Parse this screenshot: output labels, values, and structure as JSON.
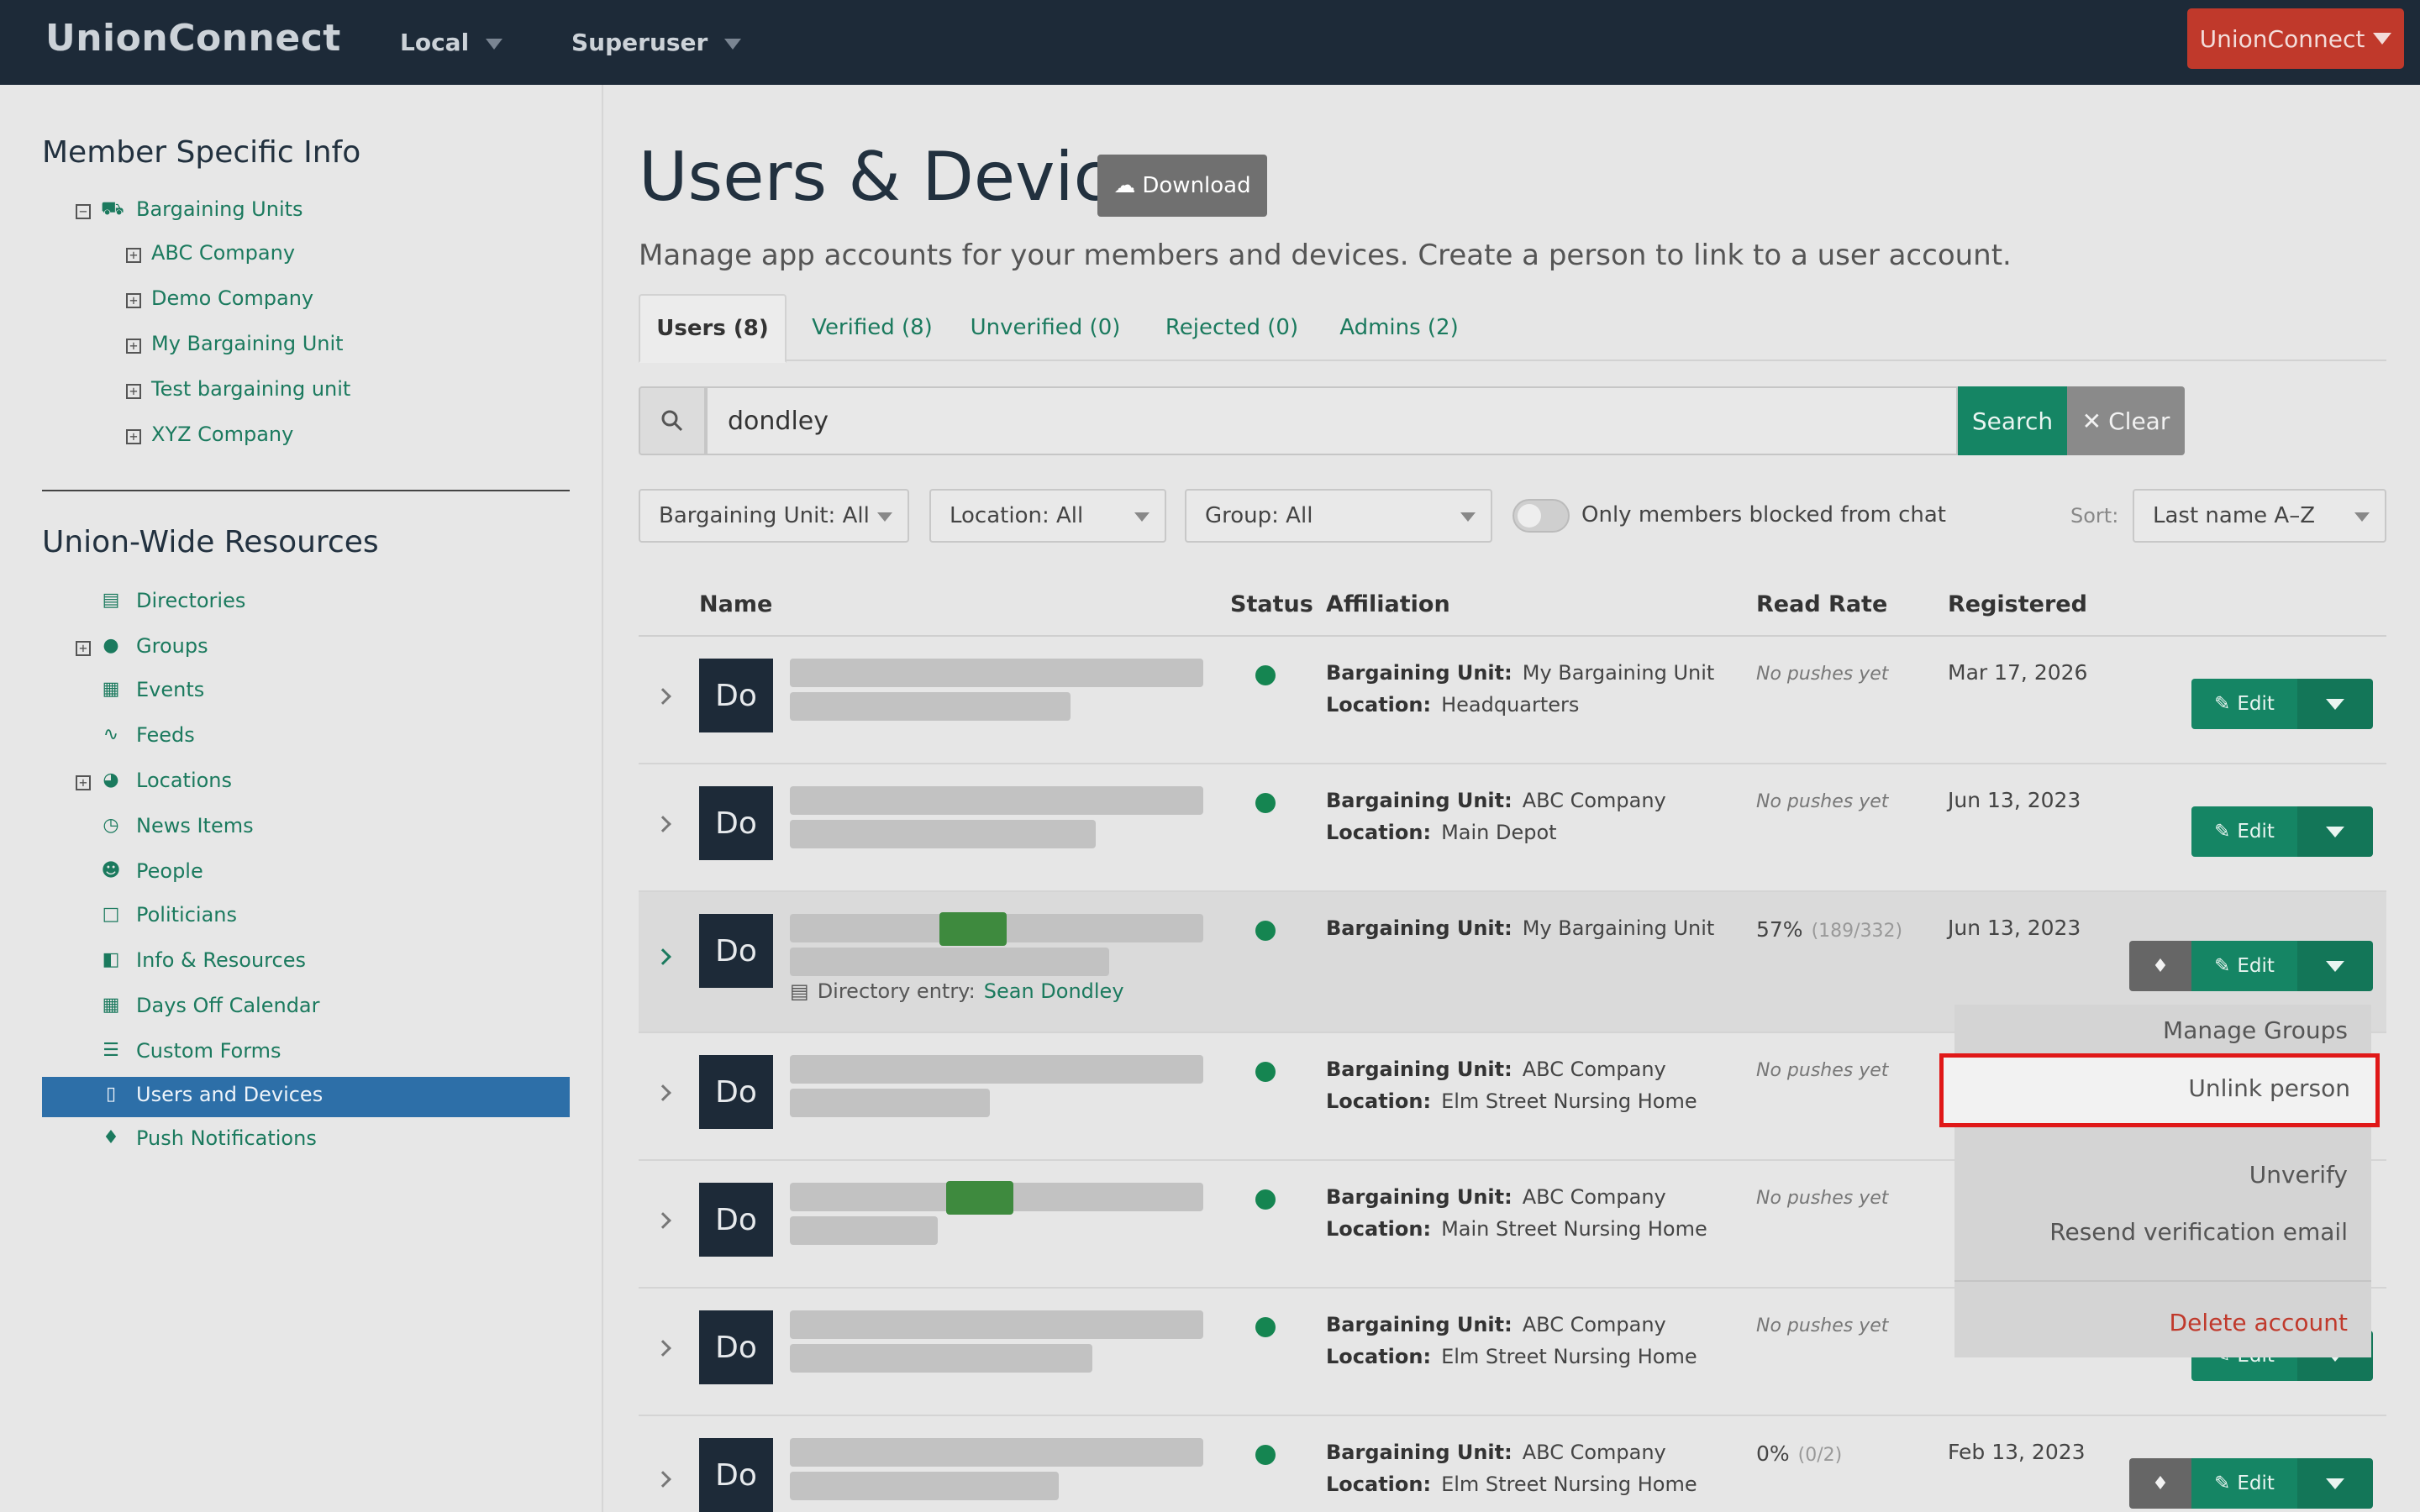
{
  "topbar": {
    "brand": "UnionConnect",
    "nav_local": "Local",
    "nav_superuser": "Superuser",
    "org_button": "UnionConnect"
  },
  "sidebar": {
    "member_heading": "Member Specific Info",
    "bargaining_units": "Bargaining Units",
    "units": [
      "ABC Company",
      "Demo Company",
      "My Bargaining Unit",
      "Test bargaining unit",
      "XYZ Company"
    ],
    "union_heading": "Union-Wide Resources",
    "resources": [
      "Directories",
      "Groups",
      "Events",
      "Feeds",
      "Locations",
      "News Items",
      "People",
      "Politicians",
      "Info & Resources",
      "Days Off Calendar",
      "Custom Forms",
      "Users and Devices",
      "Push Notifications"
    ],
    "active_item": "Users and Devices"
  },
  "page": {
    "title": "Users & Devices",
    "download_label": "Download",
    "subtitle": "Manage app accounts for your members and devices. Create a person to link to a user account."
  },
  "tabs": [
    "Users (8)",
    "Verified (8)",
    "Unverified (0)",
    "Rejected (0)",
    "Admins (2)"
  ],
  "search": {
    "value": "dondley",
    "search_label": "Search",
    "clear_label": "Clear"
  },
  "filters": {
    "bargaining_unit": "Bargaining Unit: All",
    "location": "Location: All",
    "group": "Group: All",
    "blocked_toggle": "Only members blocked from chat",
    "sort_label": "Sort:",
    "sort_value": "Last name A–Z"
  },
  "table": {
    "headers": [
      "Name",
      "Status",
      "Affiliation",
      "Read Rate",
      "Registered"
    ],
    "bu_label": "Bargaining Unit:",
    "loc_label": "Location:",
    "edit_label": "Edit",
    "avatar_text": "Do",
    "rows": [
      {
        "unit": "My Bargaining Unit",
        "location": "Headquarters",
        "read": "No pushes yet",
        "registered": "Mar 17, 2026"
      },
      {
        "unit": "ABC Company",
        "location": "Main Depot",
        "read": "No pushes yet",
        "registered": "Jun 13, 2023"
      },
      {
        "unit": "My Bargaining Unit",
        "location": "",
        "read_pct": "57%",
        "read_frac": "(189/332)",
        "registered": "Jun 13, 2023",
        "directory_label": "Directory entry:",
        "directory_name": "Sean Dondley"
      },
      {
        "unit": "ABC Company",
        "location": "Elm Street Nursing Home",
        "read": "No pushes yet",
        "registered": ""
      },
      {
        "unit": "ABC Company",
        "location": "Main Street Nursing Home",
        "read": "No pushes yet",
        "registered": ""
      },
      {
        "unit": "ABC Company",
        "location": "Elm Street Nursing Home",
        "read": "No pushes yet",
        "registered": ""
      },
      {
        "unit": "ABC Company",
        "location": "Elm Street Nursing Home",
        "read_pct": "0%",
        "read_frac": "(0/2)",
        "registered": "Feb 13, 2023"
      }
    ]
  },
  "menu": {
    "manage_groups": "Manage Groups",
    "unlink_person": "Unlink person",
    "unverify": "Unverify",
    "resend": "Resend verification email",
    "delete": "Delete account",
    "delete_color": "#c0392b",
    "highlight_color": "#e01818"
  },
  "colors": {
    "accent": "#158564",
    "link": "#1b7a5e",
    "topbar": "#1d2a38",
    "active_nav": "#2d6fa8"
  }
}
